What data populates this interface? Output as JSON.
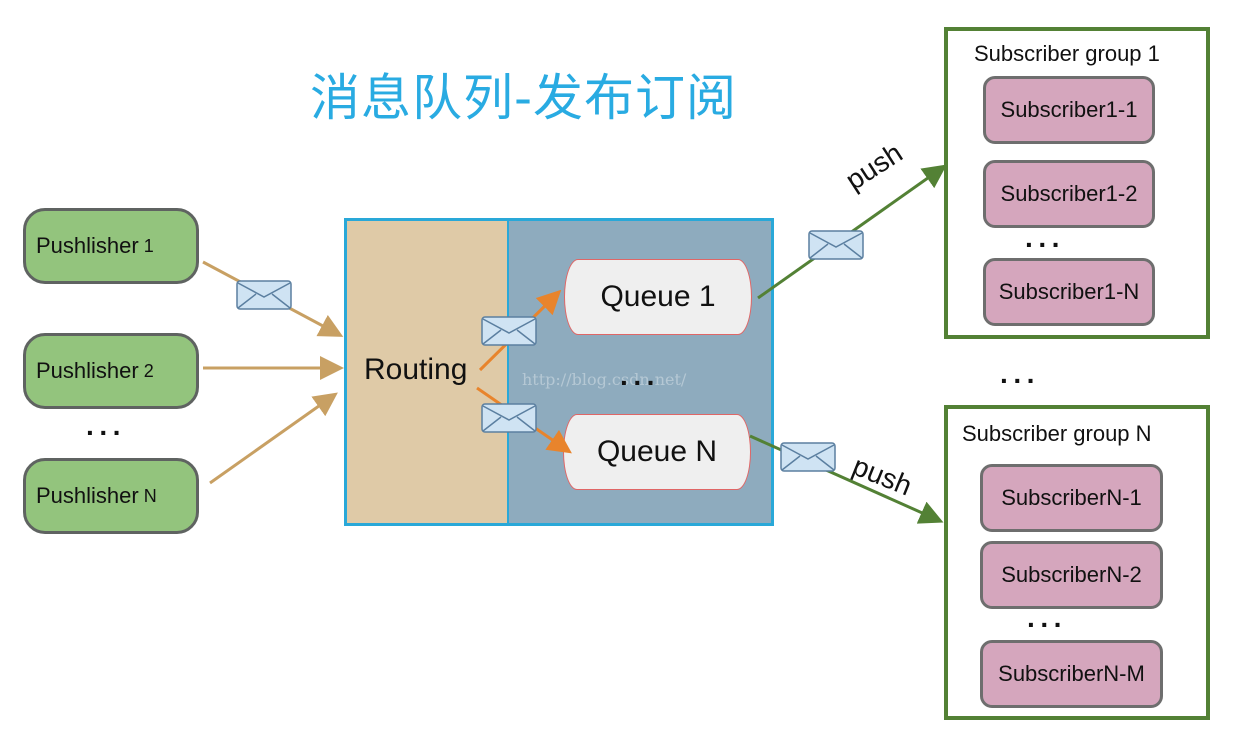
{
  "title": "消息队列-发布订阅",
  "publishers": [
    {
      "name": "Pushlisher",
      "index": "1"
    },
    {
      "name": "Pushlisher",
      "index": "2"
    },
    {
      "name": "Pushlisher",
      "index": "N"
    }
  ],
  "ellipsis": "···",
  "broker": {
    "routing_label": "Routing",
    "queues": [
      "Queue 1",
      "Queue N"
    ],
    "watermark": "http://blog.csdn.net/"
  },
  "push_label": "push",
  "subscriber_groups": [
    {
      "title": "Subscriber group 1",
      "subscribers": [
        "Subscriber1-1",
        "Subscriber1-2",
        "Subscriber1-N"
      ]
    },
    {
      "title": "Subscriber group N",
      "subscribers": [
        "SubscriberN-1",
        "SubscriberN-2",
        "SubscriberN-M"
      ]
    }
  ],
  "colors": {
    "title": "#29abe2",
    "publisher_fill": "#93c47d",
    "routing_fill": "#dfcaa7",
    "broker_fill": "#8eabbe",
    "broker_border": "#29a8d8",
    "queue_border": "#e06666",
    "subscriber_fill": "#d5a6bd",
    "group_border": "#538135",
    "publisher_arrow": "#c8a063",
    "routing_arrow": "#e8842c",
    "push_arrow": "#538135"
  }
}
